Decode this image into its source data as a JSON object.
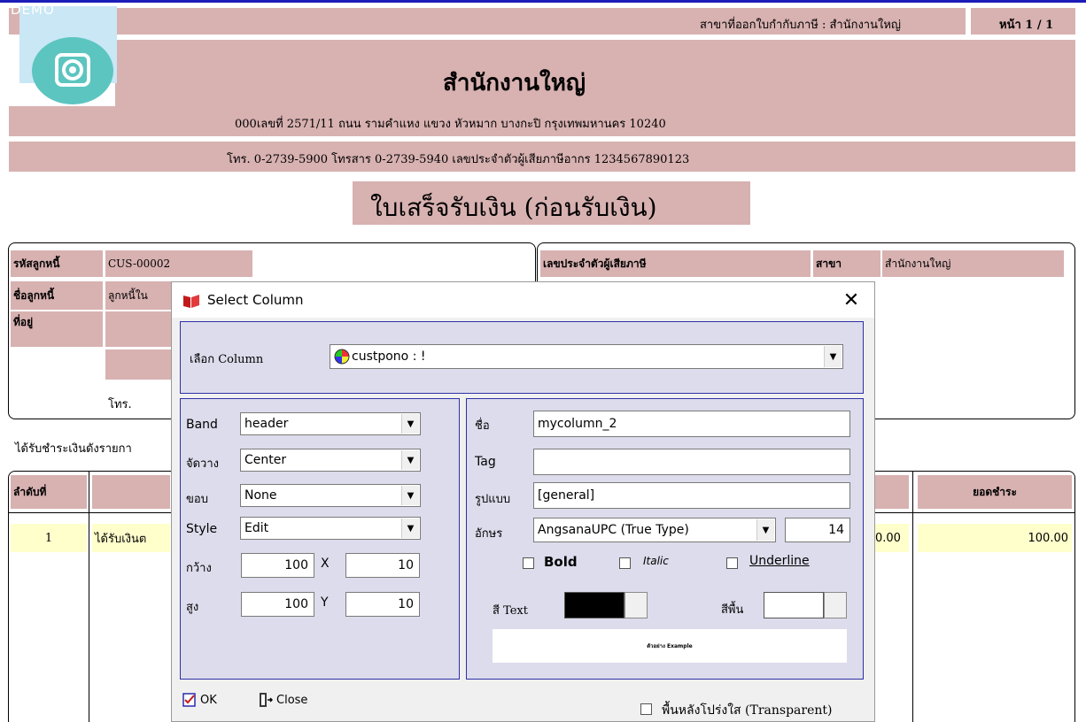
{
  "report": {
    "branch_label": "สาขาที่ออกใบกำกับภาษี : สำนักงานใหญ่",
    "page_label": "หน้า 1 / 1",
    "demo_text": "DEMO",
    "company_name": "สำนักงานใหญ่",
    "address": "000เลขที่ 2571/11 ถนน รามคำแหง แขวง หัวหมาก  บางกะปิ กรุงเทพมหานคร 10240",
    "contact": "โทร. 0-2739-5900  โทรสาร 0-2739-5940  เลขประจำตัวผู้เสียภาษีอากร 1234567890123",
    "doc_title": "ใบเสร็จรับเงิน (ก่อนรับเงิน)",
    "customer_code_label": "รหัสลูกหนี้",
    "customer_code": "CUS-00002",
    "customer_name_label": "ชื่อลูกหนี้",
    "customer_name_partial": "ลูกหนี้ใน",
    "address_label": "ที่อยู่",
    "tel_label": "โทร.",
    "tax_id_label": "เลขประจำตัวผู้เสียภาษี",
    "branch_col_label": "สาขา",
    "branch_value": "สำนักงานใหญ่",
    "received_label": "ได้รับชำระเงินดังรายกา",
    "col_seq": "ลำดับที่",
    "col_payment": "ยอดชำระ",
    "row1_seq": "1",
    "row1_desc": "ได้รับเงินต",
    "row1_partial_amount": "0.00",
    "row1_amount": "100.00"
  },
  "dialog": {
    "title": "Select Column",
    "select_column_label": "เลือก Column",
    "select_column_value": "custpono : !",
    "band_label": "Band",
    "band_value": "header",
    "align_label": "จัดวาง",
    "align_value": "Center",
    "border_label": "ขอบ",
    "border_value": "None",
    "style_label": "Style",
    "style_value": "Edit",
    "width_label": "กว้าง",
    "width_value": "100",
    "x_label": "X",
    "x_value": "10",
    "height_label": "สูง",
    "height_value": "100",
    "y_label": "Y",
    "y_value": "10",
    "name_label": "ชื่อ",
    "name_value": "mycolumn_2",
    "tag_label": "Tag",
    "tag_value": "",
    "format_label": "รูปแบบ",
    "format_value": "[general]",
    "font_label": "อักษร",
    "font_value": "AngsanaUPC (True Type)",
    "font_size": "14",
    "bold_label": "Bold",
    "italic_label": "Italic",
    "underline_label": "Underline",
    "text_color_label": "สี Text",
    "bg_color_label": "สีพื้น",
    "example_text": "ตัวอย่าง Example",
    "ok_label": "OK",
    "close_label": "Close",
    "transparent_label": "พื้นหลังโปร่งใส (Transparent)"
  },
  "colors": {
    "header_band": "#d8b1b1",
    "logo_bg": "#c9e7f5",
    "logo_circle": "#5cc5c0",
    "dialog_inner": "#dcdcec",
    "dialog_border": "#2f2fa8",
    "row_highlight": "#ffffcc",
    "text_color_swatch": "#000000",
    "bg_color_swatch": "#ffffff"
  },
  "icons": {
    "logo": "gear-camera-icon",
    "dialog_title": "red-book-icon",
    "column_type": "color-wheel-icon",
    "ok": "checkmark-doc-icon",
    "close": "door-exit-icon"
  }
}
